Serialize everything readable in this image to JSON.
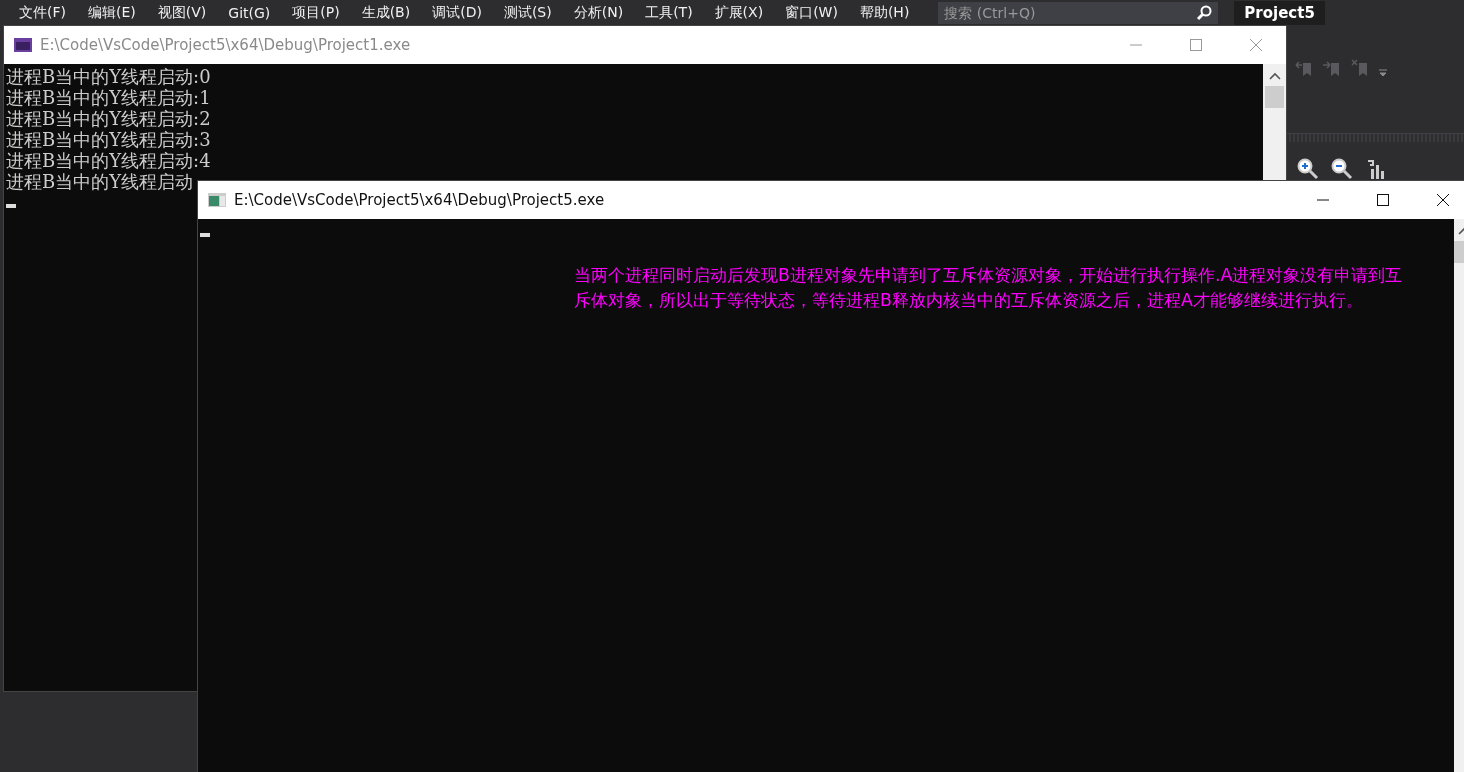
{
  "menu_bar": {
    "items": [
      "文件(F)",
      "编辑(E)",
      "视图(V)",
      "Git(G)",
      "项目(P)",
      "生成(B)",
      "调试(D)",
      "测试(S)",
      "分析(N)",
      "工具(T)",
      "扩展(X)",
      "窗口(W)",
      "帮助(H)"
    ],
    "search": {
      "placeholder": "搜索 (Ctrl+Q)"
    },
    "project_name": "Project5"
  },
  "windows": [
    {
      "title": "E:\\Code\\VsCode\\Project5\\x64\\Debug\\Project1.exe",
      "active": false,
      "lines": [
        "进程B当中的Y线程启动:0",
        "进程B当中的Y线程启动:1",
        "进程B当中的Y线程启动:2",
        "进程B当中的Y线程启动:3",
        "进程B当中的Y线程启动:4",
        "进程B当中的Y线程启动"
      ]
    },
    {
      "title": "E:\\Code\\VsCode\\Project5\\x64\\Debug\\Project5.exe",
      "active": true,
      "annotation": "当两个进程同时启动后发现B进程对象先申请到了互斥体资源对象，开始进行执行操作.A进程对象没有申请到互斥体对象，所以出于等待状态，等待进程B释放内核当中的互斥体资源之后，进程A才能够继续进行执行。"
    }
  ]
}
